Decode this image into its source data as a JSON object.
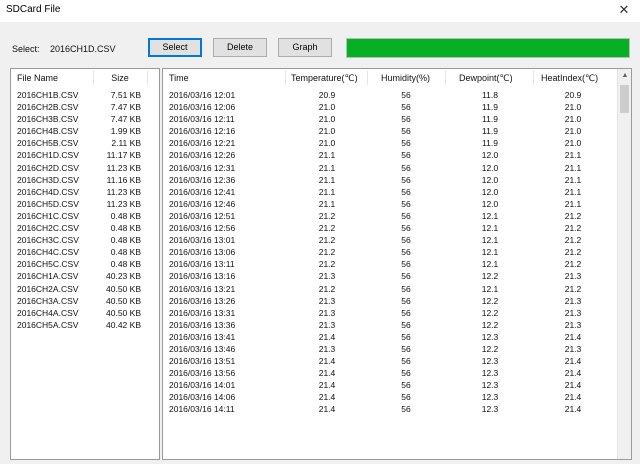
{
  "window": {
    "title": "SDCard File",
    "close_glyph": "✕"
  },
  "toolbar": {
    "select_label": "Select:",
    "selected_file": "2016CH1D.CSV",
    "select_button": "Select",
    "delete_button": "Delete",
    "graph_button": "Graph",
    "progress_percent": 100,
    "progress_color": "#06b025"
  },
  "file_list": {
    "headers": {
      "name": "File Name",
      "size": "Size"
    },
    "rows": [
      {
        "name": "2016CH1B.CSV",
        "size": "7.51 KB"
      },
      {
        "name": "2016CH2B.CSV",
        "size": "7.47 KB"
      },
      {
        "name": "2016CH3B.CSV",
        "size": "7.47 KB"
      },
      {
        "name": "2016CH4B.CSV",
        "size": "1.99 KB"
      },
      {
        "name": "2016CH5B.CSV",
        "size": "2.11 KB"
      },
      {
        "name": "2016CH1D.CSV",
        "size": "11.17 KB"
      },
      {
        "name": "2016CH2D.CSV",
        "size": "11.23 KB"
      },
      {
        "name": "2016CH3D.CSV",
        "size": "11.16 KB"
      },
      {
        "name": "2016CH4D.CSV",
        "size": "11.23 KB"
      },
      {
        "name": "2016CH5D.CSV",
        "size": "11.23 KB"
      },
      {
        "name": "2016CH1C.CSV",
        "size": "0.48 KB"
      },
      {
        "name": "2016CH2C.CSV",
        "size": "0.48 KB"
      },
      {
        "name": "2016CH3C.CSV",
        "size": "0.48 KB"
      },
      {
        "name": "2016CH4C.CSV",
        "size": "0.48 KB"
      },
      {
        "name": "2016CH5C.CSV",
        "size": "0.48 KB"
      },
      {
        "name": "2016CH1A.CSV",
        "size": "40.23 KB"
      },
      {
        "name": "2016CH2A.CSV",
        "size": "40.50 KB"
      },
      {
        "name": "2016CH3A.CSV",
        "size": "40.50 KB"
      },
      {
        "name": "2016CH4A.CSV",
        "size": "40.50 KB"
      },
      {
        "name": "2016CH5A.CSV",
        "size": "40.42 KB"
      }
    ]
  },
  "data_table": {
    "headers": {
      "time": "Time",
      "temperature": "Temperature(℃)",
      "humidity": "Humidity(%)",
      "dewpoint": "Dewpoint(℃)",
      "heatindex": "HeatIndex(℃)"
    },
    "rows": [
      {
        "time": "2016/03/16 12:01",
        "temperature": "20.9",
        "humidity": "56",
        "dewpoint": "11.8",
        "heatindex": "20.9"
      },
      {
        "time": "2016/03/16 12:06",
        "temperature": "21.0",
        "humidity": "56",
        "dewpoint": "11.9",
        "heatindex": "21.0"
      },
      {
        "time": "2016/03/16 12:11",
        "temperature": "21.0",
        "humidity": "56",
        "dewpoint": "11.9",
        "heatindex": "21.0"
      },
      {
        "time": "2016/03/16 12:16",
        "temperature": "21.0",
        "humidity": "56",
        "dewpoint": "11.9",
        "heatindex": "21.0"
      },
      {
        "time": "2016/03/16 12:21",
        "temperature": "21.0",
        "humidity": "56",
        "dewpoint": "11.9",
        "heatindex": "21.0"
      },
      {
        "time": "2016/03/16 12:26",
        "temperature": "21.1",
        "humidity": "56",
        "dewpoint": "12.0",
        "heatindex": "21.1"
      },
      {
        "time": "2016/03/16 12:31",
        "temperature": "21.1",
        "humidity": "56",
        "dewpoint": "12.0",
        "heatindex": "21.1"
      },
      {
        "time": "2016/03/16 12:36",
        "temperature": "21.1",
        "humidity": "56",
        "dewpoint": "12.0",
        "heatindex": "21.1"
      },
      {
        "time": "2016/03/16 12:41",
        "temperature": "21.1",
        "humidity": "56",
        "dewpoint": "12.0",
        "heatindex": "21.1"
      },
      {
        "time": "2016/03/16 12:46",
        "temperature": "21.1",
        "humidity": "56",
        "dewpoint": "12.0",
        "heatindex": "21.1"
      },
      {
        "time": "2016/03/16 12:51",
        "temperature": "21.2",
        "humidity": "56",
        "dewpoint": "12.1",
        "heatindex": "21.2"
      },
      {
        "time": "2016/03/16 12:56",
        "temperature": "21.2",
        "humidity": "56",
        "dewpoint": "12.1",
        "heatindex": "21.2"
      },
      {
        "time": "2016/03/16 13:01",
        "temperature": "21.2",
        "humidity": "56",
        "dewpoint": "12.1",
        "heatindex": "21.2"
      },
      {
        "time": "2016/03/16 13:06",
        "temperature": "21.2",
        "humidity": "56",
        "dewpoint": "12.1",
        "heatindex": "21.2"
      },
      {
        "time": "2016/03/16 13:11",
        "temperature": "21.2",
        "humidity": "56",
        "dewpoint": "12.1",
        "heatindex": "21.2"
      },
      {
        "time": "2016/03/16 13:16",
        "temperature": "21.3",
        "humidity": "56",
        "dewpoint": "12.2",
        "heatindex": "21.3"
      },
      {
        "time": "2016/03/16 13:21",
        "temperature": "21.2",
        "humidity": "56",
        "dewpoint": "12.1",
        "heatindex": "21.2"
      },
      {
        "time": "2016/03/16 13:26",
        "temperature": "21.3",
        "humidity": "56",
        "dewpoint": "12.2",
        "heatindex": "21.3"
      },
      {
        "time": "2016/03/16 13:31",
        "temperature": "21.3",
        "humidity": "56",
        "dewpoint": "12.2",
        "heatindex": "21.3"
      },
      {
        "time": "2016/03/16 13:36",
        "temperature": "21.3",
        "humidity": "56",
        "dewpoint": "12.2",
        "heatindex": "21.3"
      },
      {
        "time": "2016/03/16 13:41",
        "temperature": "21.4",
        "humidity": "56",
        "dewpoint": "12.3",
        "heatindex": "21.4"
      },
      {
        "time": "2016/03/16 13:46",
        "temperature": "21.3",
        "humidity": "56",
        "dewpoint": "12.2",
        "heatindex": "21.3"
      },
      {
        "time": "2016/03/16 13:51",
        "temperature": "21.4",
        "humidity": "56",
        "dewpoint": "12.3",
        "heatindex": "21.4"
      },
      {
        "time": "2016/03/16 13:56",
        "temperature": "21.4",
        "humidity": "56",
        "dewpoint": "12.3",
        "heatindex": "21.4"
      },
      {
        "time": "2016/03/16 14:01",
        "temperature": "21.4",
        "humidity": "56",
        "dewpoint": "12.3",
        "heatindex": "21.4"
      },
      {
        "time": "2016/03/16 14:06",
        "temperature": "21.4",
        "humidity": "56",
        "dewpoint": "12.3",
        "heatindex": "21.4"
      },
      {
        "time": "2016/03/16 14:11",
        "temperature": "21.4",
        "humidity": "56",
        "dewpoint": "12.3",
        "heatindex": "21.4"
      }
    ]
  },
  "scrollbar": {
    "up_glyph": "▲"
  }
}
